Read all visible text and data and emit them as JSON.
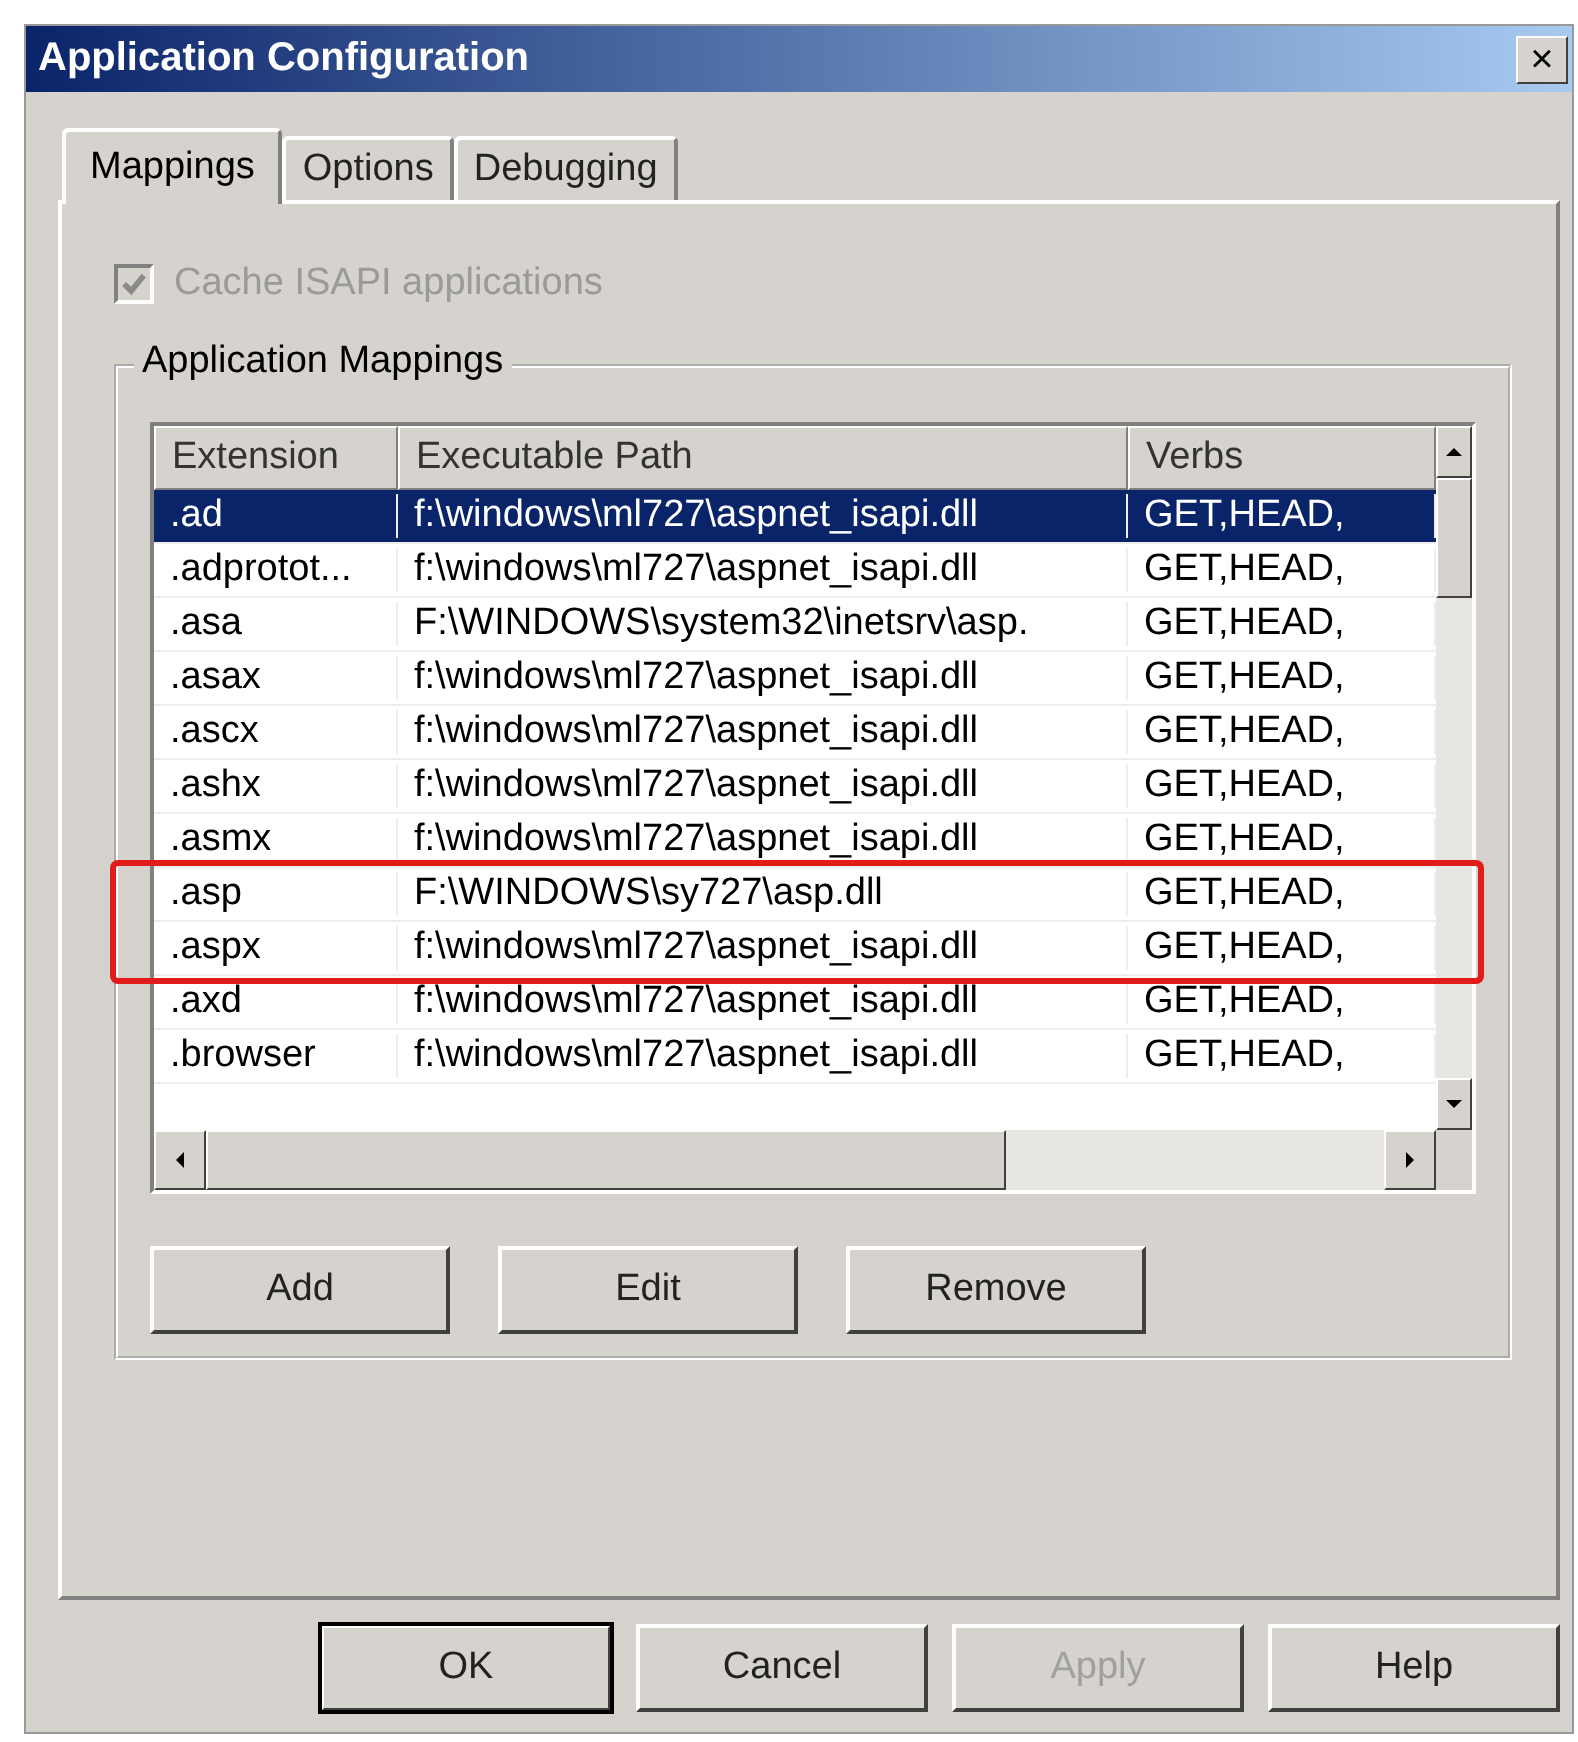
{
  "window": {
    "title": "Application Configuration",
    "close": "×"
  },
  "tabs": [
    {
      "label": "Mappings",
      "selected": true
    },
    {
      "label": "Options",
      "selected": false
    },
    {
      "label": "Debugging",
      "selected": false
    }
  ],
  "cache_checkbox": {
    "label": "Cache ISAPI applications",
    "checked": true,
    "disabled": true
  },
  "group": {
    "title": "Application Mappings"
  },
  "table": {
    "columns": [
      "Extension",
      "Executable Path",
      "Verbs"
    ],
    "rows": [
      {
        "extension": ".ad",
        "path": "f:\\windows\\ml727\\aspnet_isapi.dll",
        "verbs": "GET,HEAD,",
        "selected": true,
        "highlighted": false
      },
      {
        "extension": ".adprotot...",
        "path": "f:\\windows\\ml727\\aspnet_isapi.dll",
        "verbs": "GET,HEAD,",
        "selected": false,
        "highlighted": false
      },
      {
        "extension": ".asa",
        "path": "F:\\WINDOWS\\system32\\inetsrv\\asp.",
        "verbs": "GET,HEAD,",
        "selected": false,
        "highlighted": false
      },
      {
        "extension": ".asax",
        "path": "f:\\windows\\ml727\\aspnet_isapi.dll",
        "verbs": "GET,HEAD,",
        "selected": false,
        "highlighted": false
      },
      {
        "extension": ".ascx",
        "path": "f:\\windows\\ml727\\aspnet_isapi.dll",
        "verbs": "GET,HEAD,",
        "selected": false,
        "highlighted": false
      },
      {
        "extension": ".ashx",
        "path": "f:\\windows\\ml727\\aspnet_isapi.dll",
        "verbs": "GET,HEAD,",
        "selected": false,
        "highlighted": false
      },
      {
        "extension": ".asmx",
        "path": "f:\\windows\\ml727\\aspnet_isapi.dll",
        "verbs": "GET,HEAD,",
        "selected": false,
        "highlighted": false
      },
      {
        "extension": ".asp",
        "path": "F:\\WINDOWS\\sy727\\asp.dll",
        "verbs": "GET,HEAD,",
        "selected": false,
        "highlighted": true
      },
      {
        "extension": ".aspx",
        "path": "f:\\windows\\ml727\\aspnet_isapi.dll",
        "verbs": "GET,HEAD,",
        "selected": false,
        "highlighted": true
      },
      {
        "extension": ".axd",
        "path": "f:\\windows\\ml727\\aspnet_isapi.dll",
        "verbs": "GET,HEAD,",
        "selected": false,
        "highlighted": false
      },
      {
        "extension": ".browser",
        "path": "f:\\windows\\ml727\\aspnet_isapi.dll",
        "verbs": "GET,HEAD,",
        "selected": false,
        "highlighted": false
      }
    ]
  },
  "list_buttons": [
    {
      "label": "Add",
      "disabled": false
    },
    {
      "label": "Edit",
      "disabled": false
    },
    {
      "label": "Remove",
      "disabled": false
    }
  ],
  "dialog_buttons": [
    {
      "label": "OK",
      "disabled": false,
      "default": true
    },
    {
      "label": "Cancel",
      "disabled": false,
      "default": false
    },
    {
      "label": "Apply",
      "disabled": true,
      "default": false
    },
    {
      "label": "Help",
      "disabled": false,
      "default": false
    }
  ]
}
